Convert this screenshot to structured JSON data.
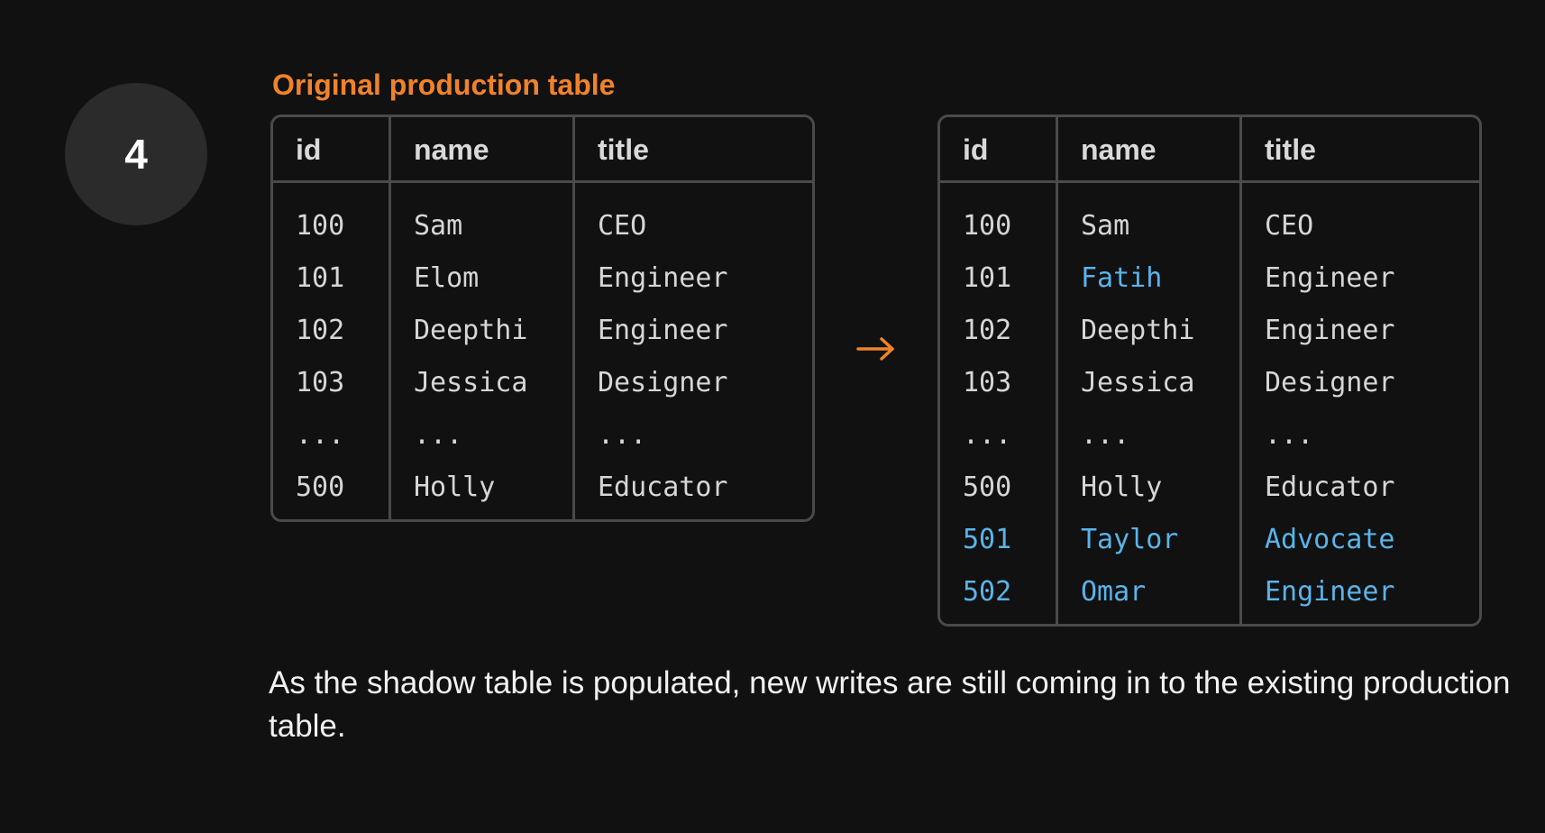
{
  "step": {
    "number": "4"
  },
  "original_table": {
    "caption": "Original production table",
    "columns": {
      "id": "id",
      "name": "name",
      "title": "title"
    },
    "rows": [
      {
        "id": "100",
        "name": "Sam",
        "title": "CEO",
        "new_id": false,
        "new_name": false,
        "new_title": false
      },
      {
        "id": "101",
        "name": "Elom",
        "title": "Engineer",
        "new_id": false,
        "new_name": false,
        "new_title": false
      },
      {
        "id": "102",
        "name": "Deepthi",
        "title": "Engineer",
        "new_id": false,
        "new_name": false,
        "new_title": false
      },
      {
        "id": "103",
        "name": "Jessica",
        "title": "Designer",
        "new_id": false,
        "new_name": false,
        "new_title": false
      },
      {
        "id": "...",
        "name": "...",
        "title": "...",
        "new_id": false,
        "new_name": false,
        "new_title": false
      },
      {
        "id": "500",
        "name": "Holly",
        "title": "Educator",
        "new_id": false,
        "new_name": false,
        "new_title": false
      }
    ]
  },
  "updated_table": {
    "columns": {
      "id": "id",
      "name": "name",
      "title": "title"
    },
    "rows": [
      {
        "id": "100",
        "name": "Sam",
        "title": "CEO",
        "new_id": false,
        "new_name": false,
        "new_title": false
      },
      {
        "id": "101",
        "name": "Fatih",
        "title": "Engineer",
        "new_id": false,
        "new_name": true,
        "new_title": false
      },
      {
        "id": "102",
        "name": "Deepthi",
        "title": "Engineer",
        "new_id": false,
        "new_name": false,
        "new_title": false
      },
      {
        "id": "103",
        "name": "Jessica",
        "title": "Designer",
        "new_id": false,
        "new_name": false,
        "new_title": false
      },
      {
        "id": "...",
        "name": "...",
        "title": "...",
        "new_id": false,
        "new_name": false,
        "new_title": false
      },
      {
        "id": "500",
        "name": "Holly",
        "title": "Educator",
        "new_id": false,
        "new_name": false,
        "new_title": false
      },
      {
        "id": "501",
        "name": "Taylor",
        "title": "Advocate",
        "new_id": true,
        "new_name": true,
        "new_title": true
      },
      {
        "id": "502",
        "name": "Omar",
        "title": "Engineer",
        "new_id": true,
        "new_name": true,
        "new_title": true
      }
    ]
  },
  "arrow": {
    "icon": "right-arrow-icon",
    "color": "#f0822a"
  },
  "colors": {
    "accent": "#f0822a",
    "highlight": "#5ab4ea",
    "background": "#111111",
    "border": "#4a4a4a"
  },
  "description": "As the shadow table is populated, new writes are still coming in to the existing production table."
}
